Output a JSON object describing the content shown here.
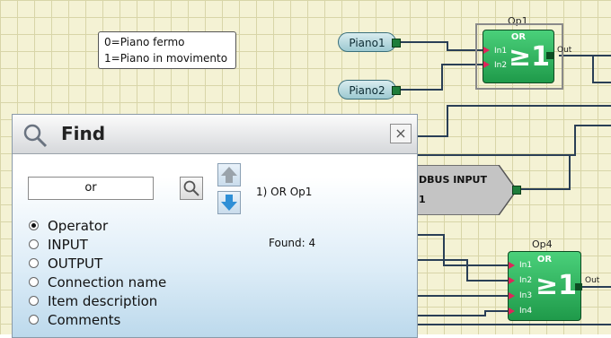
{
  "note": {
    "line1": "0=Piano fermo",
    "line2": "1=Piano in movimento"
  },
  "inputs": [
    {
      "label": "Piano1"
    },
    {
      "label": "Piano2"
    }
  ],
  "gates": [
    {
      "name": "Op1",
      "type": "OR",
      "symbol": "≥1",
      "inputs": [
        "In1",
        "In2"
      ],
      "output": "Out"
    },
    {
      "name": "Op4",
      "type": "OR",
      "symbol": "≥1",
      "inputs": [
        "In1",
        "In2",
        "In3",
        "In4"
      ],
      "output": "Out"
    }
  ],
  "modbus_block": {
    "label": "DBUS INPUT",
    "value": "1"
  },
  "find_dialog": {
    "title": "Find",
    "search_value": "or",
    "result_item": "1) OR Op1",
    "found_text": "Found: 4",
    "options": [
      {
        "label": "Operator",
        "selected": true
      },
      {
        "label": "INPUT",
        "selected": false
      },
      {
        "label": "OUTPUT",
        "selected": false
      },
      {
        "label": "Connection name",
        "selected": false
      },
      {
        "label": "Item description",
        "selected": false
      },
      {
        "label": "Comments",
        "selected": false
      }
    ],
    "close_glyph": "×"
  },
  "colors": {
    "gate_green": "#2bb55a",
    "wire": "#2a3f56",
    "pin_red": "#e0245a",
    "canvas": "#f4f2d4"
  }
}
